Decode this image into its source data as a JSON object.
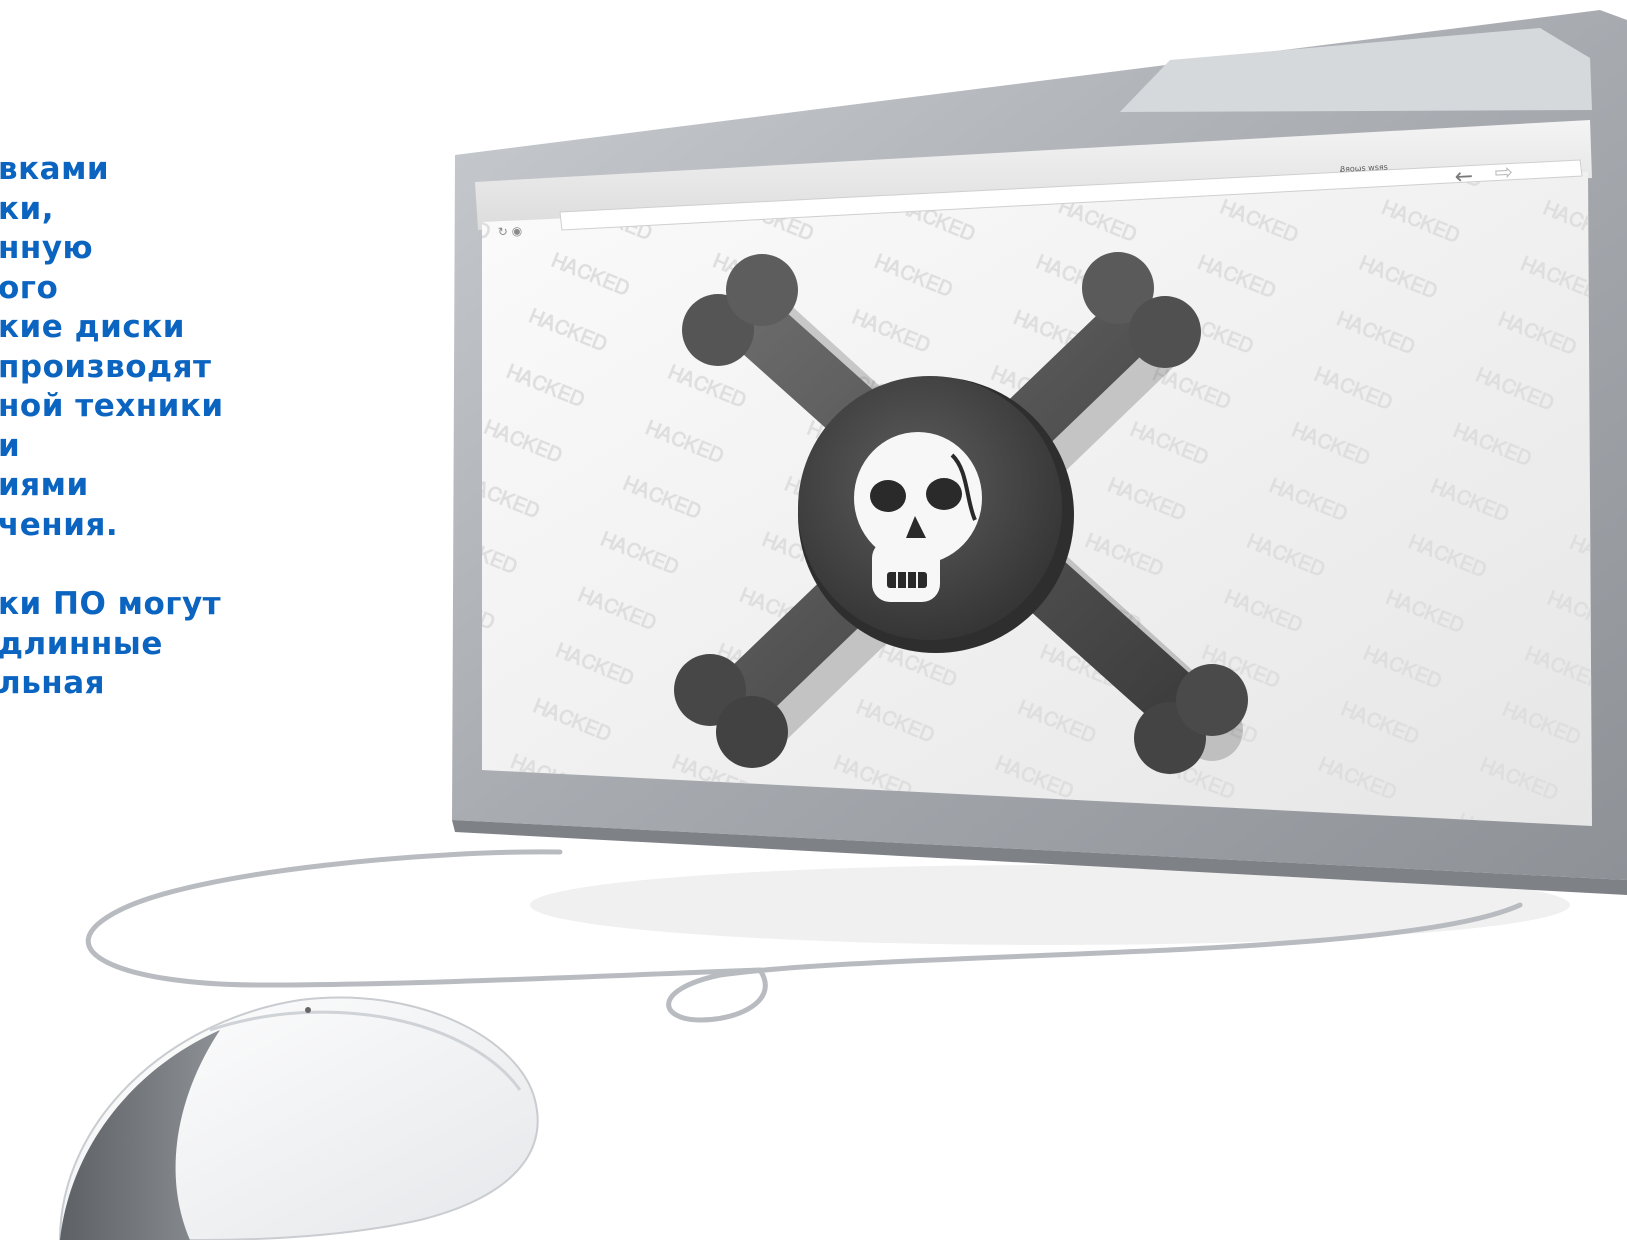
{
  "paragraph_1": [
    "вками",
    "ки,",
    "нную",
    "ого",
    "кие диски",
    "производят",
    "ной техники",
    "и",
    "иями",
    "чения."
  ],
  "paragraph_2": [
    "ки ПО могут",
    "длинные",
    "льная"
  ],
  "browser": {
    "address_text": "Ᏸяоѡѕ ԝѕяѕ"
  },
  "colors": {
    "text": "#0b64c0",
    "icon_dark": "#4a4a4a",
    "frame": "#9a9ea3"
  },
  "icons": [
    "monitor-icon",
    "skull-and-crossbones-icon",
    "mouse-icon",
    "back-arrow-icon",
    "forward-arrow-icon"
  ]
}
